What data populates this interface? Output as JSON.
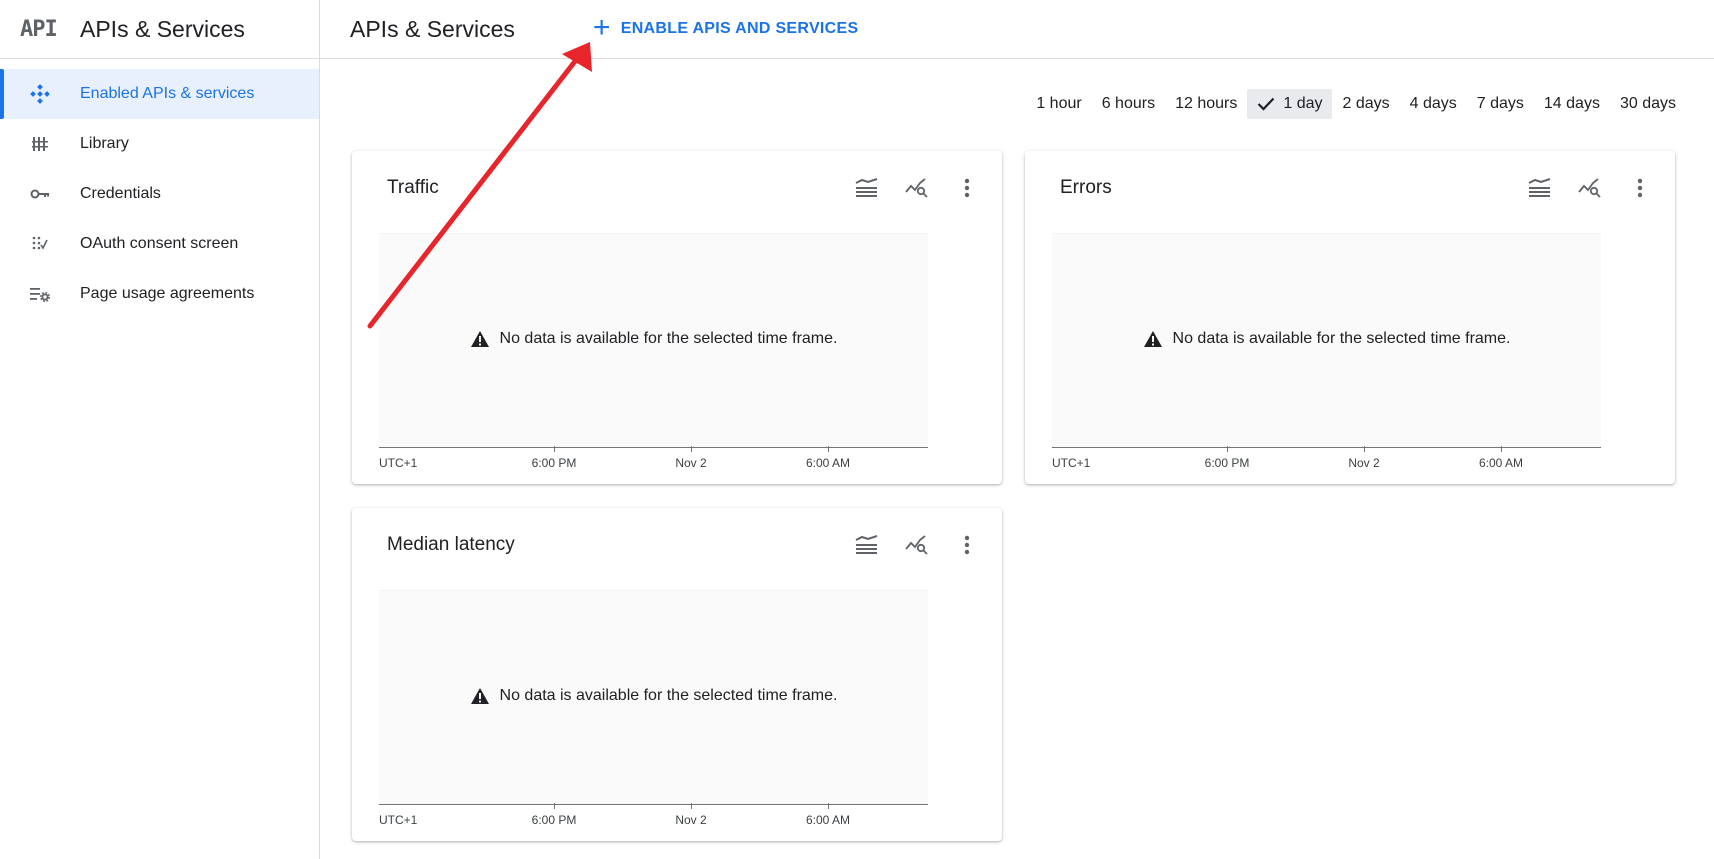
{
  "app": {
    "logo_text": "API",
    "title": "APIs & Services"
  },
  "sidebar": {
    "items": [
      {
        "label": "Enabled APIs & services",
        "icon": "enabled-apis-icon",
        "active": true
      },
      {
        "label": "Library",
        "icon": "library-icon",
        "active": false
      },
      {
        "label": "Credentials",
        "icon": "key-icon",
        "active": false
      },
      {
        "label": "OAuth consent screen",
        "icon": "oauth-icon",
        "active": false
      },
      {
        "label": "Page usage agreements",
        "icon": "settings-list-icon",
        "active": false
      }
    ]
  },
  "header": {
    "title": "APIs & Services",
    "enable_button": {
      "icon": "plus-icon",
      "label": "ENABLE APIS AND SERVICES"
    }
  },
  "time_range": {
    "options": [
      "1 hour",
      "6 hours",
      "12 hours",
      "1 day",
      "2 days",
      "4 days",
      "7 days",
      "14 days",
      "30 days"
    ],
    "selected": "1 day"
  },
  "cards": [
    {
      "title": "Traffic",
      "message": "No data is available for the selected time frame."
    },
    {
      "title": "Errors",
      "message": "No data is available for the selected time frame."
    },
    {
      "title": "Median latency",
      "message": "No data is available for the selected time frame."
    }
  ],
  "axis": {
    "labels": [
      "UTC+1",
      "6:00 PM",
      "Nov 2",
      "6:00 AM"
    ]
  },
  "colors": {
    "accent": "#1a73e8",
    "active_bg": "#e8f0fe",
    "annotation_arrow": "#e8252b"
  }
}
